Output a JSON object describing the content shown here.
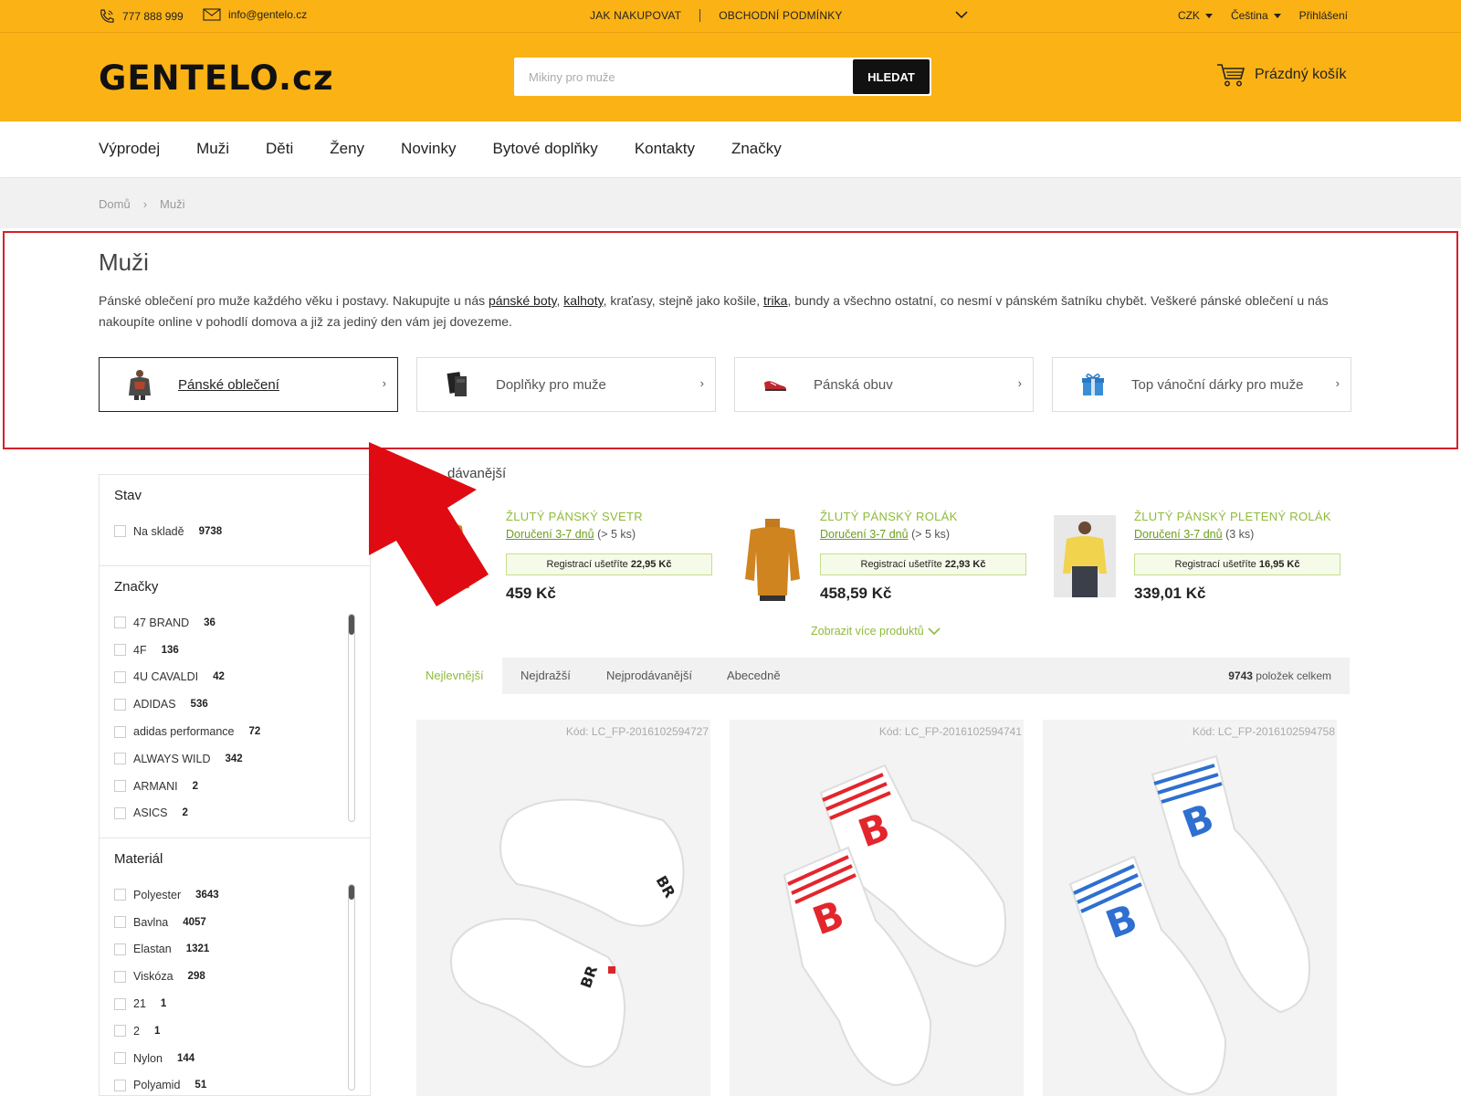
{
  "topbar": {
    "phone": "777 888 999",
    "email": "info@gentelo.cz",
    "links": [
      "JAK NAKUPOVAT",
      "OBCHODNÍ PODMÍNKY"
    ],
    "currency": "CZK",
    "language": "Čeština",
    "login": "Přihlášení"
  },
  "header": {
    "logo": "GENTELO.cz",
    "search_placeholder": "Mikiny pro muže",
    "search_button": "HLEDAT",
    "cart": "Prázdný košík"
  },
  "nav": [
    "Výprodej",
    "Muži",
    "Děti",
    "Ženy",
    "Novinky",
    "Bytové doplňky",
    "Kontakty",
    "Značky"
  ],
  "breadcrumb": [
    "Domů",
    "Muži"
  ],
  "intro": {
    "title": "Muži",
    "text_1": "Pánské oblečení pro muže každého věku i postavy. Nakupujte u nás ",
    "link_1": "pánské boty",
    "text_2": ", ",
    "link_2": "kalhoty",
    "text_3": ", kraťasy, stejně jako košile, ",
    "link_3": "trika",
    "text_4": ", bundy a všechno ostatní, co nesmí v pánském šatníku chybět. Veškeré pánské oblečení u nás nakoupíte online v pohodlí domova a již za jediný den vám jej dovezeme."
  },
  "categories": [
    {
      "label": "Pánské oblečení",
      "icon": "sweater-thumbnail-icon",
      "active": true
    },
    {
      "label": "Doplňky pro muže",
      "icon": "wallet-thumbnail-icon",
      "active": false
    },
    {
      "label": "Pánská obuv",
      "icon": "shoe-thumbnail-icon",
      "active": false
    },
    {
      "label": "Top vánoční dárky pro muže",
      "icon": "gift-thumbnail-icon",
      "active": false
    }
  ],
  "filters": {
    "stav": {
      "title": "Stav",
      "items": [
        {
          "label": "Na skladě",
          "count": "9738"
        }
      ]
    },
    "znacky": {
      "title": "Značky",
      "items": [
        {
          "label": "47 BRAND",
          "count": "36"
        },
        {
          "label": "4F",
          "count": "136"
        },
        {
          "label": "4U CAVALDI",
          "count": "42"
        },
        {
          "label": "ADIDAS",
          "count": "536"
        },
        {
          "label": "adidas performance",
          "count": "72"
        },
        {
          "label": "ALWAYS WILD",
          "count": "342"
        },
        {
          "label": "ARMANI",
          "count": "2"
        },
        {
          "label": "ASICS",
          "count": "2"
        }
      ]
    },
    "material": {
      "title": "Materiál",
      "items": [
        {
          "label": "Polyester",
          "count": "3643"
        },
        {
          "label": "Bavlna",
          "count": "4057"
        },
        {
          "label": "Elastan",
          "count": "1321"
        },
        {
          "label": "Viskóza",
          "count": "298"
        },
        {
          "label": "21",
          "count": "1"
        },
        {
          "label": "2",
          "count": "1"
        },
        {
          "label": "Nylon",
          "count": "144"
        },
        {
          "label": "Polyamid",
          "count": "51"
        }
      ]
    }
  },
  "bestsellers": {
    "title_visible": "dávanější",
    "items": [
      {
        "name": "ŽLUTÝ PÁNSKÝ SVETR",
        "delivery": "Doručení 3-7 dnů",
        "stock": " (> 5 ks)",
        "reg_text": "Registrací ušetříte ",
        "saving": "22,95 Kč",
        "price": "459 Kč"
      },
      {
        "name": "ŽLUTÝ PÁNSKÝ ROLÁK",
        "delivery": "Doručení 3-7 dnů",
        "stock": " (> 5 ks)",
        "reg_text": "Registrací ušetříte ",
        "saving": "22,93 Kč",
        "price": "458,59 Kč"
      },
      {
        "name": "ŽLUTÝ PÁNSKÝ PLETENÝ ROLÁK",
        "delivery": "Doručení 3-7 dnů",
        "stock": " (3 ks)",
        "reg_text": "Registrací ušetříte ",
        "saving": "16,95 Kč",
        "price": "339,01 Kč"
      }
    ],
    "more": "Zobrazit více produktů"
  },
  "sort": {
    "tabs": [
      "Nejlevnější",
      "Nejdražší",
      "Nejprodávanější",
      "Abecedně"
    ],
    "active": "Nejlevnější",
    "total_count": "9743",
    "total_label": " položek celkem"
  },
  "products": [
    {
      "code": "Kód: LC_FP-2016102594727",
      "accent": "#d9262c"
    },
    {
      "code": "Kód: LC_FP-2016102594741",
      "accent": "#e3262c"
    },
    {
      "code": "Kód: LC_FP-2016102594758",
      "accent": "#2e6fd0"
    }
  ],
  "colors": {
    "brand": "#fbb215",
    "highlight_box": "#d61f2c",
    "arrow": "#e00b12",
    "accent_green": "#8fbb3a"
  }
}
